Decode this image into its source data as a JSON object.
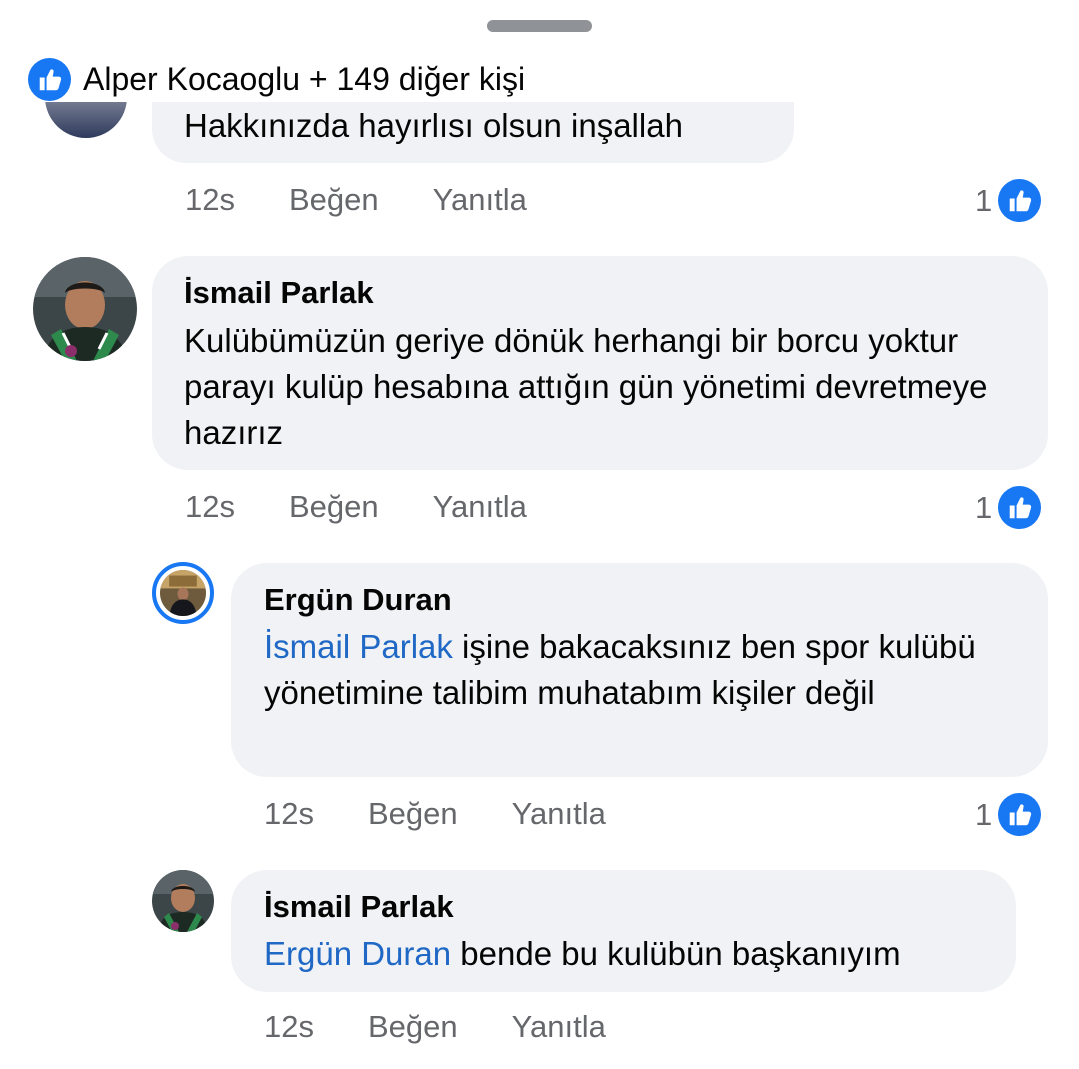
{
  "reactions": {
    "icon": "like-icon",
    "summary": "Alper Kocaoglu + 149 diğer kişi"
  },
  "previous_comment": {
    "text_fragment": "Hakkınızda hayırlısı olsun inşallah",
    "time": "12s",
    "like_label": "Beğen",
    "reply_label": "Yanıtla",
    "like_count": "1"
  },
  "comments": [
    {
      "author": "İsmail Parlak",
      "body": "Kulübümüzün geriye dönük herhangi bir borcu yoktur parayı kulüp hesabına attığın gün yönetimi devretmeye hazırız",
      "time": "12s",
      "like_label": "Beğen",
      "reply_label": "Yanıtla",
      "like_count": "1"
    },
    {
      "author": "Ergün Duran",
      "mention": "İsmail Parlak",
      "body": " işine bakacaksınız ben spor kulübü yönetimine talibim muhatabım kişiler değil",
      "time": "12s",
      "like_label": "Beğen",
      "reply_label": "Yanıtla",
      "like_count": "1"
    },
    {
      "author": "İsmail Parlak",
      "mention": "Ergün Duran",
      "body": " bende bu kulübün başkanıyım",
      "time": "12s",
      "like_label": "Beğen",
      "reply_label": "Yanıtla"
    }
  ],
  "colors": {
    "like_blue": "#1877f2",
    "mention_blue": "#1f68c5",
    "bubble_bg": "#f0f2f5",
    "meta_gray": "#65676b",
    "story_ring": "#1877f2"
  }
}
